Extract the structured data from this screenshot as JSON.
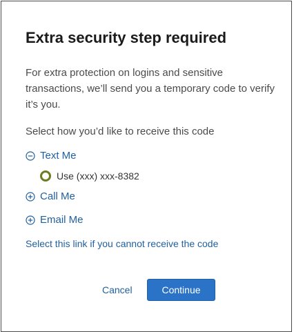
{
  "dialog": {
    "title": "Extra security step required",
    "intro": "For extra protection on logins and sensitive transactions, we’ll send you a temporary code to verify it’s you.",
    "select_prompt": "Select how you’d like to receive this code",
    "options": [
      {
        "label": "Text Me",
        "icon": "minus-circle-icon",
        "expanded": true
      },
      {
        "label": "Call Me",
        "icon": "plus-circle-icon",
        "expanded": false
      },
      {
        "label": "Email Me",
        "icon": "plus-circle-icon",
        "expanded": false
      }
    ],
    "phone_option": {
      "label": "Use (xxx) xxx-8382",
      "selected": false
    },
    "help_link": "Select this link if you cannot receive the code",
    "cancel_label": "Cancel",
    "continue_label": "Continue"
  },
  "colors": {
    "link": "#1f5f9e",
    "primary_button": "#2b73c7",
    "radio": "#6b7d22",
    "border": "#4a4a4a"
  }
}
